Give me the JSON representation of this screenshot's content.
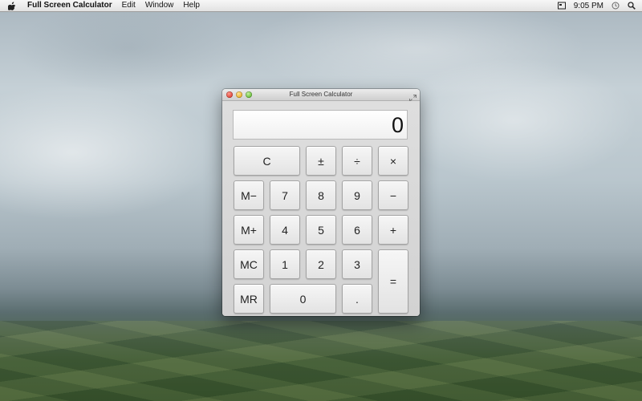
{
  "menubar": {
    "app_name": "Full Screen Calculator",
    "items": [
      "Edit",
      "Window",
      "Help"
    ],
    "time": "9:05 PM",
    "status_icons": [
      "screen-sharing-icon",
      "time-machine-icon",
      "spotlight-icon"
    ]
  },
  "window": {
    "title": "Full Screen Calculator"
  },
  "calculator": {
    "display_value": "0",
    "buttons": {
      "clear": "C",
      "plus_minus": "±",
      "divide": "÷",
      "multiply": "×",
      "m_minus": "M−",
      "seven": "7",
      "eight": "8",
      "nine": "9",
      "subtract": "−",
      "m_plus": "M+",
      "four": "4",
      "five": "5",
      "six": "6",
      "add": "+",
      "mc": "MC",
      "one": "1",
      "two": "2",
      "three": "3",
      "equals": "=",
      "mr": "MR",
      "zero": "0",
      "decimal": "."
    }
  }
}
